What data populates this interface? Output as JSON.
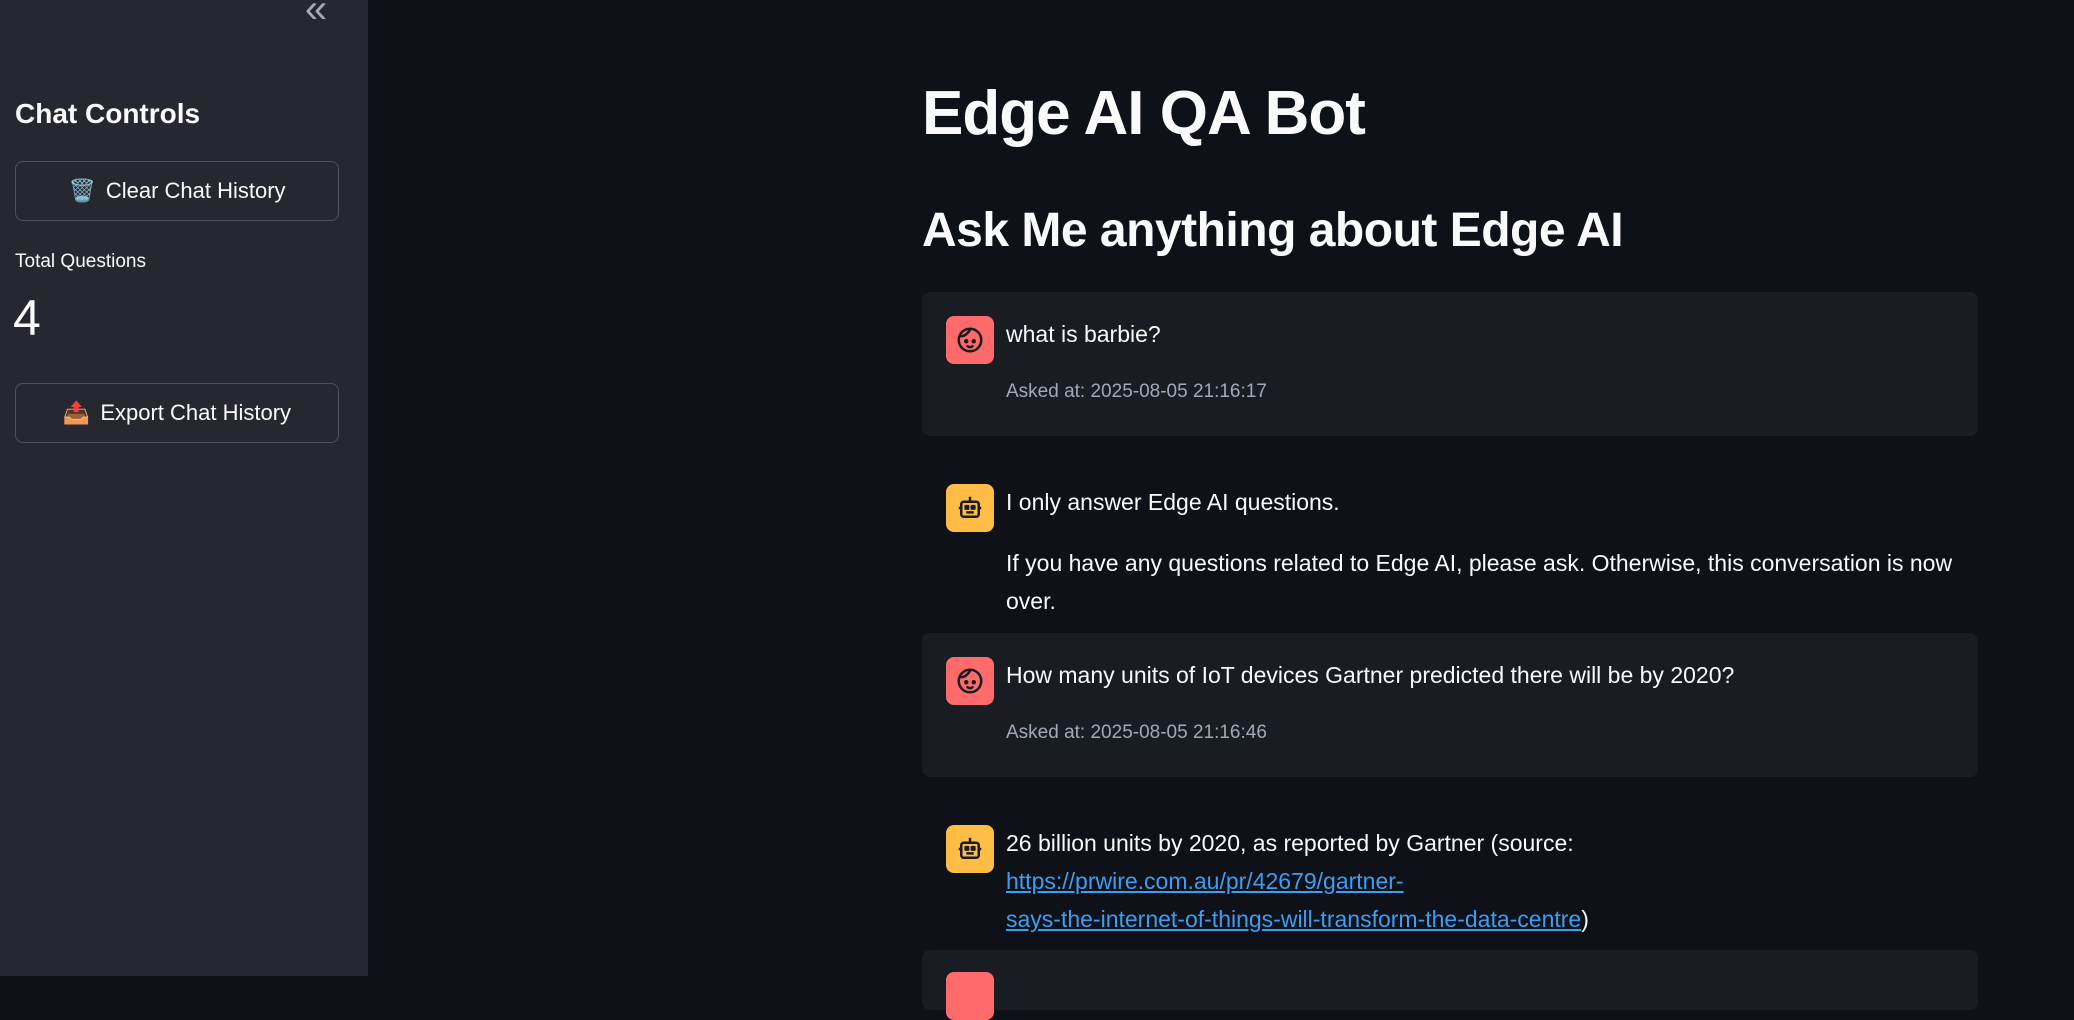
{
  "sidebar": {
    "collapse_glyph": "«",
    "title": "Chat Controls",
    "clear_button": {
      "icon": "wastebasket-icon",
      "glyph": "🗑️",
      "label": "Clear Chat History"
    },
    "metric": {
      "label": "Total Questions",
      "value": "4"
    },
    "export_button": {
      "icon": "outbox-icon",
      "glyph": "📤",
      "label": "Export Chat History"
    }
  },
  "main": {
    "title": "Edge AI QA Bot",
    "subtitle": "Ask Me anything about Edge AI",
    "messages": [
      {
        "role": "user",
        "text": "what is barbie?",
        "meta": "Asked at: 2025-08-05 21:16:17"
      },
      {
        "role": "assistant",
        "text": "I only answer Edge AI questions.",
        "text2": "If you have any questions related to Edge AI, please ask. Otherwise, this conversation is now over."
      },
      {
        "role": "user",
        "text": "How many units of IoT devices Gartner predicted there will be by 2020?",
        "meta": "Asked at: 2025-08-05 21:16:46"
      },
      {
        "role": "assistant",
        "text_pre": "26 billion units by 2020, as reported by Gartner (source: ",
        "link_part1": "https://prwire.com.au/pr/42679/gartner-",
        "link_part2": "says-the-internet-of-things-will-transform-the-data-centre",
        "text_post": ")"
      }
    ]
  },
  "colors": {
    "background": "#0e1117",
    "sidebar": "#262730",
    "user_avatar": "#ff6b6b",
    "bot_avatar": "#ffbd45",
    "link": "#3d9df3"
  }
}
